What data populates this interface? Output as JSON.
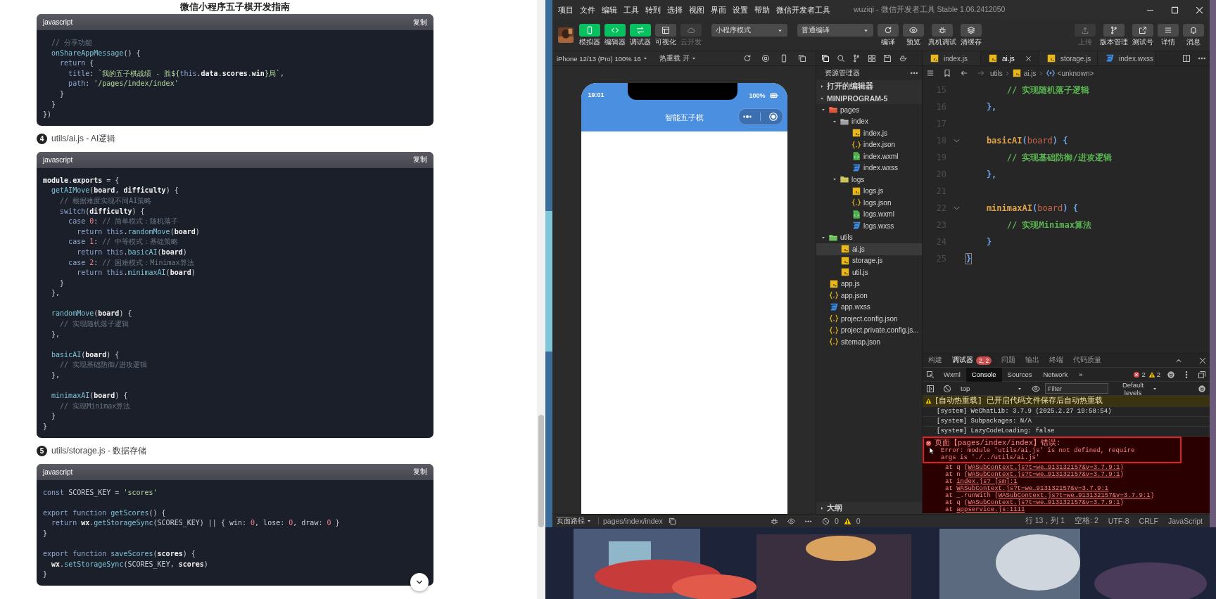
{
  "doc": {
    "title": "微信小程序五子棋开发指南",
    "sections": [
      {
        "code": {
          "language": "javascript",
          "copy": "复制",
          "groups": [
            [
              [
                {
                  "kind": "cm",
                  "text": "  // 分享功能"
                }
              ],
              [
                {
                  "kind": "fn",
                  "text": "  onShareAppMessage"
                },
                {
                  "kind": "pl",
                  "text": "() {"
                }
              ],
              [
                {
                  "kind": "kw",
                  "text": "    return"
                },
                {
                  "kind": "pl",
                  "text": " {"
                }
              ],
              [
                {
                  "kind": "kw",
                  "text": "      title"
                },
                {
                  "kind": "pl",
                  "text": ": "
                },
                {
                  "kind": "str",
                  "text": "`我的五子棋战绩 - 胜${"
                },
                {
                  "kind": "kw",
                  "text": "this"
                },
                {
                  "kind": "pl",
                  "text": "."
                },
                {
                  "kind": "bd",
                  "text": "data"
                },
                {
                  "kind": "pl",
                  "text": "."
                },
                {
                  "kind": "bd",
                  "text": "scores"
                },
                {
                  "kind": "pl",
                  "text": "."
                },
                {
                  "kind": "bd",
                  "text": "win"
                },
                {
                  "kind": "str",
                  "text": "}局`"
                },
                {
                  "kind": "pl",
                  "text": ","
                }
              ],
              [
                {
                  "kind": "kw",
                  "text": "      path"
                },
                {
                  "kind": "pl",
                  "text": ": "
                },
                {
                  "kind": "str",
                  "text": "'/pages/index/index'"
                }
              ],
              [
                {
                  "kind": "pl",
                  "text": "    }"
                }
              ],
              [
                {
                  "kind": "pl",
                  "text": "  }"
                }
              ],
              [
                {
                  "kind": "pl",
                  "text": "})"
                }
              ]
            ]
          ]
        }
      },
      {
        "heading": {
          "number": "4",
          "text": "utils/ai.js - AI逻辑"
        },
        "code": {
          "language": "javascript",
          "copy": "复制",
          "groups": [
            [
              [
                {
                  "kind": "bd",
                  "text": "module"
                },
                {
                  "kind": "pl",
                  "text": "."
                },
                {
                  "kind": "bd",
                  "text": "exports"
                },
                {
                  "kind": "pl",
                  "text": " = {"
                }
              ],
              [
                {
                  "kind": "fn",
                  "text": "  getAIMove"
                },
                {
                  "kind": "pl",
                  "text": "("
                },
                {
                  "kind": "bd",
                  "text": "board"
                },
                {
                  "kind": "pl",
                  "text": ", "
                },
                {
                  "kind": "bd",
                  "text": "difficulty"
                },
                {
                  "kind": "pl",
                  "text": ") {"
                }
              ],
              [
                {
                  "kind": "cm",
                  "text": "    // 根据难度实现不同AI策略"
                }
              ],
              [
                {
                  "kind": "kw",
                  "text": "    switch"
                },
                {
                  "kind": "pl",
                  "text": "("
                },
                {
                  "kind": "bd",
                  "text": "difficulty"
                },
                {
                  "kind": "pl",
                  "text": ") {"
                }
              ],
              [
                {
                  "kind": "kw",
                  "text": "      case "
                },
                {
                  "kind": "num",
                  "text": "0"
                },
                {
                  "kind": "pl",
                  "text": ": "
                },
                {
                  "kind": "cm",
                  "text": "// 简单模式：随机落子"
                }
              ],
              [
                {
                  "kind": "kw",
                  "text": "        return this"
                },
                {
                  "kind": "pl",
                  "text": "."
                },
                {
                  "kind": "fn",
                  "text": "randomMove"
                },
                {
                  "kind": "pl",
                  "text": "("
                },
                {
                  "kind": "bd",
                  "text": "board"
                },
                {
                  "kind": "pl",
                  "text": ")"
                }
              ],
              [
                {
                  "kind": "kw",
                  "text": "      case "
                },
                {
                  "kind": "num",
                  "text": "1"
                },
                {
                  "kind": "pl",
                  "text": ": "
                },
                {
                  "kind": "cm",
                  "text": "// 中等模式：基础策略"
                }
              ],
              [
                {
                  "kind": "kw",
                  "text": "        return this"
                },
                {
                  "kind": "pl",
                  "text": "."
                },
                {
                  "kind": "fn",
                  "text": "basicAI"
                },
                {
                  "kind": "pl",
                  "text": "("
                },
                {
                  "kind": "bd",
                  "text": "board"
                },
                {
                  "kind": "pl",
                  "text": ")"
                }
              ],
              [
                {
                  "kind": "kw",
                  "text": "      case "
                },
                {
                  "kind": "num",
                  "text": "2"
                },
                {
                  "kind": "pl",
                  "text": ": "
                },
                {
                  "kind": "cm",
                  "text": "// 困难模式：Minimax算法"
                }
              ],
              [
                {
                  "kind": "kw",
                  "text": "        return this"
                },
                {
                  "kind": "pl",
                  "text": "."
                },
                {
                  "kind": "fn",
                  "text": "minimaxAI"
                },
                {
                  "kind": "pl",
                  "text": "("
                },
                {
                  "kind": "bd",
                  "text": "board"
                },
                {
                  "kind": "pl",
                  "text": ")"
                }
              ],
              [
                {
                  "kind": "pl",
                  "text": "    }"
                }
              ],
              [
                {
                  "kind": "pl",
                  "text": "  },"
                }
              ]
            ],
            [
              [
                {
                  "kind": "fn",
                  "text": "  randomMove"
                },
                {
                  "kind": "pl",
                  "text": "("
                },
                {
                  "kind": "bd",
                  "text": "board"
                },
                {
                  "kind": "pl",
                  "text": ") {"
                }
              ],
              [
                {
                  "kind": "cm",
                  "text": "    // 实现随机落子逻辑"
                }
              ],
              [
                {
                  "kind": "pl",
                  "text": "  },"
                }
              ]
            ],
            [
              [
                {
                  "kind": "fn",
                  "text": "  basicAI"
                },
                {
                  "kind": "pl",
                  "text": "("
                },
                {
                  "kind": "bd",
                  "text": "board"
                },
                {
                  "kind": "pl",
                  "text": ") {"
                }
              ],
              [
                {
                  "kind": "cm",
                  "text": "    // 实现基础防御/进攻逻辑"
                }
              ],
              [
                {
                  "kind": "pl",
                  "text": "  },"
                }
              ]
            ],
            [
              [
                {
                  "kind": "fn",
                  "text": "  minimaxAI"
                },
                {
                  "kind": "pl",
                  "text": "("
                },
                {
                  "kind": "bd",
                  "text": "board"
                },
                {
                  "kind": "pl",
                  "text": ") {"
                }
              ],
              [
                {
                  "kind": "cm",
                  "text": "    // 实现Minimax算法"
                }
              ],
              [
                {
                  "kind": "pl",
                  "text": "  }"
                }
              ],
              [
                {
                  "kind": "pl",
                  "text": "}"
                }
              ]
            ]
          ]
        }
      },
      {
        "heading": {
          "number": "5",
          "text": "utils/storage.js - 数据存储"
        },
        "code": {
          "language": "javascript",
          "copy": "复制",
          "groups": [
            [
              [
                {
                  "kind": "kw",
                  "text": "const "
                },
                {
                  "kind": "pl",
                  "text": "SCORES_KEY = "
                },
                {
                  "kind": "str",
                  "text": "'scores'"
                }
              ]
            ],
            [
              [
                {
                  "kind": "kw",
                  "text": "export function "
                },
                {
                  "kind": "fn",
                  "text": "getScores"
                },
                {
                  "kind": "pl",
                  "text": "() {"
                }
              ],
              [
                {
                  "kind": "kw",
                  "text": "  return "
                },
                {
                  "kind": "bd",
                  "text": "wx"
                },
                {
                  "kind": "pl",
                  "text": "."
                },
                {
                  "kind": "fn",
                  "text": "getStorageSync"
                },
                {
                  "kind": "pl",
                  "text": "(SCORES_KEY) || { win: "
                },
                {
                  "kind": "num",
                  "text": "0"
                },
                {
                  "kind": "pl",
                  "text": ", lose: "
                },
                {
                  "kind": "num",
                  "text": "0"
                },
                {
                  "kind": "pl",
                  "text": ", draw: "
                },
                {
                  "kind": "num",
                  "text": "0"
                },
                {
                  "kind": "pl",
                  "text": " }"
                }
              ],
              [
                {
                  "kind": "pl",
                  "text": "}"
                }
              ]
            ],
            [
              [
                {
                  "kind": "kw",
                  "text": "export function "
                },
                {
                  "kind": "fn",
                  "text": "saveScores"
                },
                {
                  "kind": "pl",
                  "text": "("
                },
                {
                  "kind": "bd",
                  "text": "scores"
                },
                {
                  "kind": "pl",
                  "text": ") {"
                }
              ],
              [
                {
                  "kind": "bd",
                  "text": "  wx"
                },
                {
                  "kind": "pl",
                  "text": "."
                },
                {
                  "kind": "fn",
                  "text": "setStorageSync"
                },
                {
                  "kind": "pl",
                  "text": "(SCORES_KEY, "
                },
                {
                  "kind": "bd",
                  "text": "scores"
                },
                {
                  "kind": "pl",
                  "text": ")"
                }
              ],
              [
                {
                  "kind": "pl",
                  "text": "}"
                }
              ]
            ]
          ]
        }
      }
    ]
  },
  "ide": {
    "menu": [
      "项目",
      "文件",
      "编辑",
      "工具",
      "转到",
      "选择",
      "视图",
      "界面",
      "设置",
      "帮助",
      "微信开发者工具"
    ],
    "title": "wuziqi - 微信开发者工具 Stable 1.06.2412050",
    "mode_buttons": [
      {
        "label": "模拟器",
        "on": true,
        "disabled": false
      },
      {
        "label": "编辑器",
        "on": true,
        "disabled": false
      },
      {
        "label": "调试器",
        "on": true,
        "disabled": false
      },
      {
        "label": "可视化",
        "on": false,
        "disabled": false
      },
      {
        "label": "云开发",
        "on": false,
        "disabled": true
      }
    ],
    "mode_select": "小程序模式",
    "compile_select": "普通编译",
    "actions": [
      {
        "label": "编译",
        "disabled": false
      },
      {
        "label": "预览",
        "disabled": false
      },
      {
        "label": "真机调试",
        "disabled": false
      },
      {
        "label": "清缓存",
        "disabled": false
      }
    ],
    "right_actions": [
      {
        "label": "上传",
        "disabled": true
      },
      {
        "label": "版本管理",
        "disabled": false
      },
      {
        "label": "测试号",
        "disabled": false
      },
      {
        "label": "详情",
        "disabled": false
      },
      {
        "label": "消息",
        "disabled": false
      }
    ],
    "simulator": {
      "device": "iPhone 12/13 (Pro) 100% 16",
      "hot_reload": "热重载 开",
      "time": "19:01",
      "battery": "100%",
      "nav_title": "智能五子棋"
    },
    "explorer": {
      "title": "资源管理器",
      "sections": [
        {
          "label": "打开的编辑器",
          "expanded": false
        },
        {
          "label": "MINIPROGRAM-5",
          "expanded": true
        }
      ],
      "tree": [
        {
          "label": "pages",
          "kind": "folder",
          "color": "#e0573f",
          "expanded": true,
          "selected": false,
          "children": [
            {
              "label": "index",
              "kind": "folder",
              "color": "#9aa0a6",
              "expanded": true,
              "selected": false,
              "children": [
                {
                  "label": "index.js",
                  "kind": "js",
                  "selected": false
                },
                {
                  "label": "index.json",
                  "kind": "json",
                  "selected": false
                },
                {
                  "label": "index.wxml",
                  "kind": "wxml",
                  "selected": false
                },
                {
                  "label": "index.wxss",
                  "kind": "wxss",
                  "selected": false
                }
              ]
            },
            {
              "label": "logs",
              "kind": "folder",
              "color": "#c9c25a",
              "expanded": true,
              "selected": false,
              "children": [
                {
                  "label": "logs.js",
                  "kind": "js",
                  "selected": false
                },
                {
                  "label": "logs.json",
                  "kind": "json",
                  "selected": false
                },
                {
                  "label": "logs.wxml",
                  "kind": "wxml",
                  "selected": false
                },
                {
                  "label": "logs.wxss",
                  "kind": "wxss",
                  "selected": false
                }
              ]
            }
          ]
        },
        {
          "label": "utils",
          "kind": "folder",
          "color": "#6cbf5a",
          "expanded": true,
          "selected": false,
          "children": [
            {
              "label": "ai.js",
              "kind": "js",
              "selected": true
            },
            {
              "label": "storage.js",
              "kind": "js",
              "selected": false
            },
            {
              "label": "util.js",
              "kind": "js",
              "selected": false
            }
          ]
        },
        {
          "label": "app.js",
          "kind": "js",
          "selected": false
        },
        {
          "label": "app.json",
          "kind": "json",
          "selected": false
        },
        {
          "label": "app.wxss",
          "kind": "wxss",
          "selected": false
        },
        {
          "label": "project.config.json",
          "kind": "json",
          "selected": false
        },
        {
          "label": "project.private.config.js...",
          "kind": "json",
          "selected": false
        },
        {
          "label": "sitemap.json",
          "kind": "json",
          "selected": false
        }
      ],
      "outline": "大纲"
    },
    "tabs": [
      {
        "label": "index.js",
        "kind": "js",
        "selected": false
      },
      {
        "label": "ai.js",
        "kind": "js",
        "selected": true
      },
      {
        "label": "storage.js",
        "kind": "js",
        "selected": false
      },
      {
        "label": "index.wxss",
        "kind": "wxss",
        "selected": false
      }
    ],
    "breadcrumb": [
      {
        "label": "utils",
        "kind": "folder"
      },
      {
        "label": "ai.js",
        "kind": "js"
      },
      {
        "label": "<unknown>",
        "kind": "symbol"
      }
    ],
    "code_lines": [
      {
        "number": "15",
        "foldable": false,
        "tokens": [
          {
            "kind": "comment",
            "text": "        // 实现随机落子逻辑"
          }
        ]
      },
      {
        "number": "16",
        "foldable": false,
        "tokens": [
          {
            "kind": "punct",
            "text": "    },"
          }
        ]
      },
      {
        "number": "17",
        "foldable": false
      },
      {
        "number": "18",
        "foldable": true,
        "tokens": [
          {
            "kind": "fn",
            "text": "    basicAI"
          },
          {
            "kind": "punct",
            "text": "("
          },
          {
            "kind": "param",
            "text": "board"
          },
          {
            "kind": "punct",
            "text": ") {"
          }
        ]
      },
      {
        "number": "19",
        "foldable": false,
        "tokens": [
          {
            "kind": "comment",
            "text": "        // 实现基础防御/进攻逻辑"
          }
        ]
      },
      {
        "number": "20",
        "foldable": false,
        "tokens": [
          {
            "kind": "punct",
            "text": "    },"
          }
        ]
      },
      {
        "number": "21",
        "foldable": false
      },
      {
        "number": "22",
        "foldable": true,
        "tokens": [
          {
            "kind": "fn",
            "text": "    minimaxAI"
          },
          {
            "kind": "punct",
            "text": "("
          },
          {
            "kind": "param",
            "text": "board"
          },
          {
            "kind": "punct",
            "text": ") {"
          }
        ]
      },
      {
        "number": "23",
        "foldable": false,
        "tokens": [
          {
            "kind": "comment",
            "text": "        // 实现Minimax算法"
          }
        ]
      },
      {
        "number": "24",
        "foldable": false,
        "tokens": [
          {
            "kind": "punct",
            "text": "    }"
          }
        ]
      },
      {
        "number": "25",
        "foldable": false,
        "tokens": [
          {
            "kind": "bracket",
            "text": "}"
          }
        ]
      }
    ],
    "debug_tabs": [
      {
        "label": "构建",
        "selected": false
      },
      {
        "label": "调试器",
        "selected": true,
        "badge": "2, 2"
      },
      {
        "label": "问题",
        "selected": false
      },
      {
        "label": "输出",
        "selected": false
      },
      {
        "label": "终端",
        "selected": false
      },
      {
        "label": "代码质量",
        "selected": false
      }
    ],
    "devtools_tabs": [
      {
        "label": "Wxml",
        "selected": false
      },
      {
        "label": "Console",
        "selected": true
      },
      {
        "label": "Sources",
        "selected": false
      },
      {
        "label": "Network",
        "selected": false
      },
      {
        "label": "»",
        "selected": false
      }
    ],
    "error_count": "2",
    "warning_count": "2",
    "context": "top",
    "filter_placeholder": "Filter",
    "levels": "Default levels",
    "messages": [
      {
        "kind": "warning",
        "outlined": false,
        "text": "[自动热重载] 已开启代码文件保存后自动热重载"
      },
      {
        "kind": "log",
        "outlined": false,
        "text": "[system] WeChatLib: 3.7.9 (2025.2.27 19:58:54)"
      },
      {
        "kind": "log",
        "outlined": false,
        "text": "[system] Subpackages: N/A"
      },
      {
        "kind": "log",
        "outlined": false,
        "text": "[system] LazyCodeLoading: false"
      },
      {
        "kind": "error",
        "outlined": true,
        "text": "页面【pages/index/index】错误:",
        "detail": "Error: module 'utils/ai.js' is not defined, require args is './../utils/ai.js'",
        "stack": [
          {
            "text": "at q (",
            "link": "WASubContext.js?t=we…913132157&v=3.7.9:1",
            "after": ")"
          },
          {
            "text": "at n (",
            "link": "WASubContext.js?t=we…913132157&v=3.7.9:1",
            "after": ")"
          },
          {
            "text": "at ",
            "link": "index.js? [sm]:1"
          },
          {
            "text": "at ",
            "link": "WASubContext.js?t=we…913132157&v=3.7.9:1"
          },
          {
            "text": "at _.runWith (",
            "link": "WASubContext.js?t=we…913132157&v=3.7.9:1",
            "after": ")"
          },
          {
            "text": "at q (",
            "link": "WASubContext.js?t=we…913132157&v=3.7.9:1",
            "after": ")"
          },
          {
            "text": "at ",
            "link": "appservice.js:1111"
          }
        ]
      }
    ],
    "status": {
      "page_path_label": "页面路径",
      "page_path": "pages/index/index",
      "errors": "0",
      "warnings": "0",
      "position": "行 13，列 1",
      "indent": "空格: 2",
      "encoding": "UTF-8",
      "eol": "CRLF",
      "language": "JavaScript"
    }
  }
}
